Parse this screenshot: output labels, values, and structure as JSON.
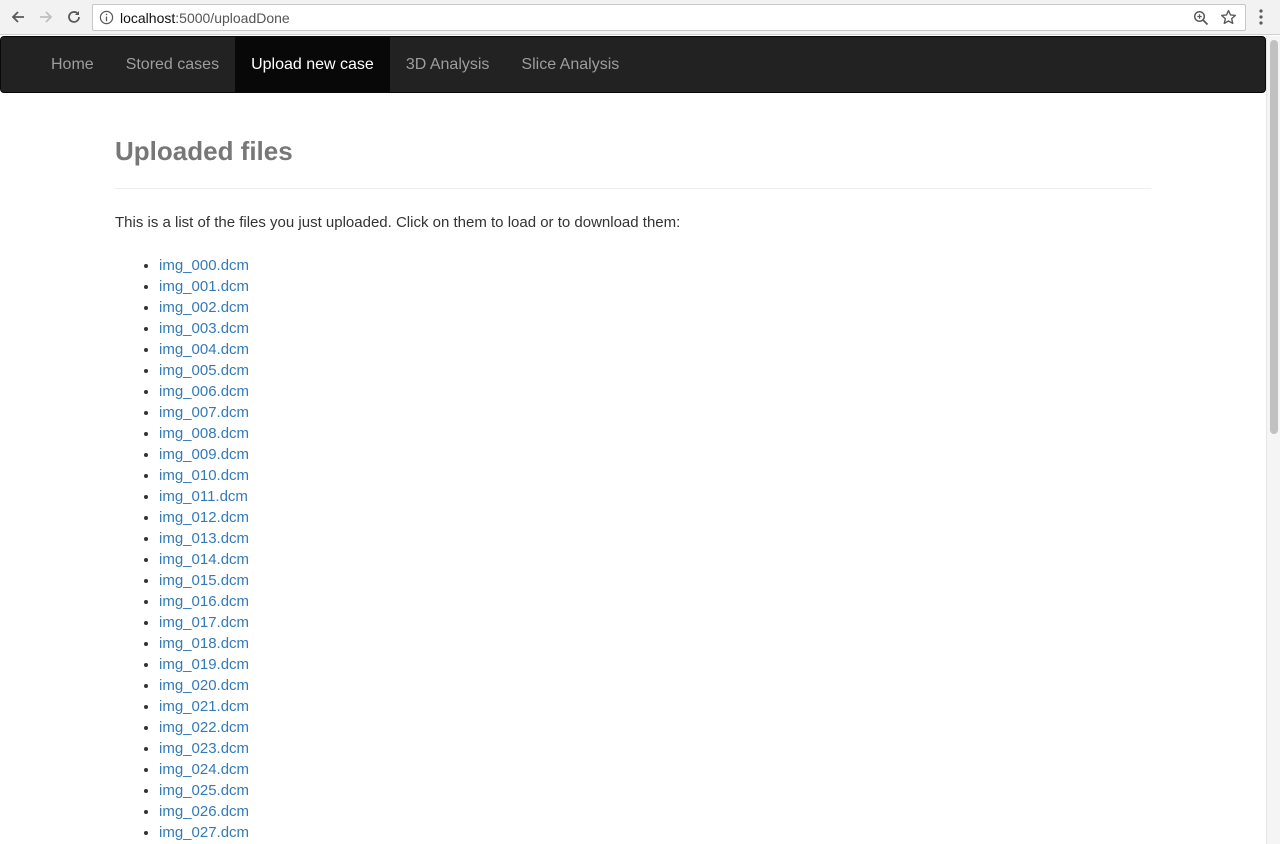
{
  "browser": {
    "url_host": "localhost",
    "url_rest": ":5000/uploadDone"
  },
  "nav": {
    "items": [
      {
        "label": "Home",
        "active": false
      },
      {
        "label": "Stored cases",
        "active": false
      },
      {
        "label": "Upload new case",
        "active": true
      },
      {
        "label": "3D Analysis",
        "active": false
      },
      {
        "label": "Slice Analysis",
        "active": false
      }
    ]
  },
  "main": {
    "title": "Uploaded files",
    "intro": "This is a list of the files you just uploaded. Click on them to load or to download them:",
    "files": [
      "img_000.dcm",
      "img_001.dcm",
      "img_002.dcm",
      "img_003.dcm",
      "img_004.dcm",
      "img_005.dcm",
      "img_006.dcm",
      "img_007.dcm",
      "img_008.dcm",
      "img_009.dcm",
      "img_010.dcm",
      "img_011.dcm",
      "img_012.dcm",
      "img_013.dcm",
      "img_014.dcm",
      "img_015.dcm",
      "img_016.dcm",
      "img_017.dcm",
      "img_018.dcm",
      "img_019.dcm",
      "img_020.dcm",
      "img_021.dcm",
      "img_022.dcm",
      "img_023.dcm",
      "img_024.dcm",
      "img_025.dcm",
      "img_026.dcm",
      "img_027.dcm"
    ]
  },
  "colors": {
    "navbar_bg": "#222222",
    "nav_active_bg": "#080808",
    "link": "#337ab7",
    "title": "#777777"
  },
  "icons": [
    "back-arrow-icon",
    "forward-arrow-icon",
    "reload-icon",
    "info-icon",
    "zoom-icon",
    "star-icon",
    "menu-kebab-icon"
  ]
}
